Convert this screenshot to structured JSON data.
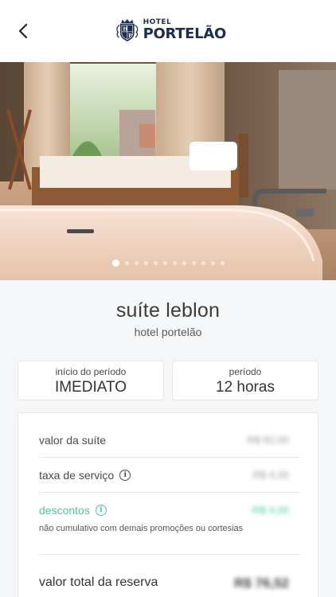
{
  "header": {
    "back_icon": "chevron-left-icon",
    "logo_small": "HOTEL",
    "logo_big": "PORTELÃO",
    "logo_monogram": "HP"
  },
  "gallery": {
    "total_images": 12,
    "active_index": 0
  },
  "suite": {
    "name": "suíte leblon",
    "hotel": "hotel portelão"
  },
  "booking": {
    "start_label": "início do período",
    "start_value": "IMEDIATO",
    "period_label": "período",
    "period_value": "12 horas"
  },
  "pricing": {
    "suite_label": "valor da suíte",
    "suite_value": "R$ 82,00",
    "service_label": "taxa de serviço",
    "service_value": "R$ 4,00",
    "discount_label": "descontos",
    "discount_value": "-R$ 4,00",
    "discount_note": "não cumulativo com demais promoções ou cortesias",
    "total_label": "valor total da reserva",
    "total_value": "R$ 76,52"
  },
  "colors": {
    "brand_navy": "#1c2d4f",
    "discount_green": "#4cc79b",
    "background": "#f5f6f7"
  }
}
